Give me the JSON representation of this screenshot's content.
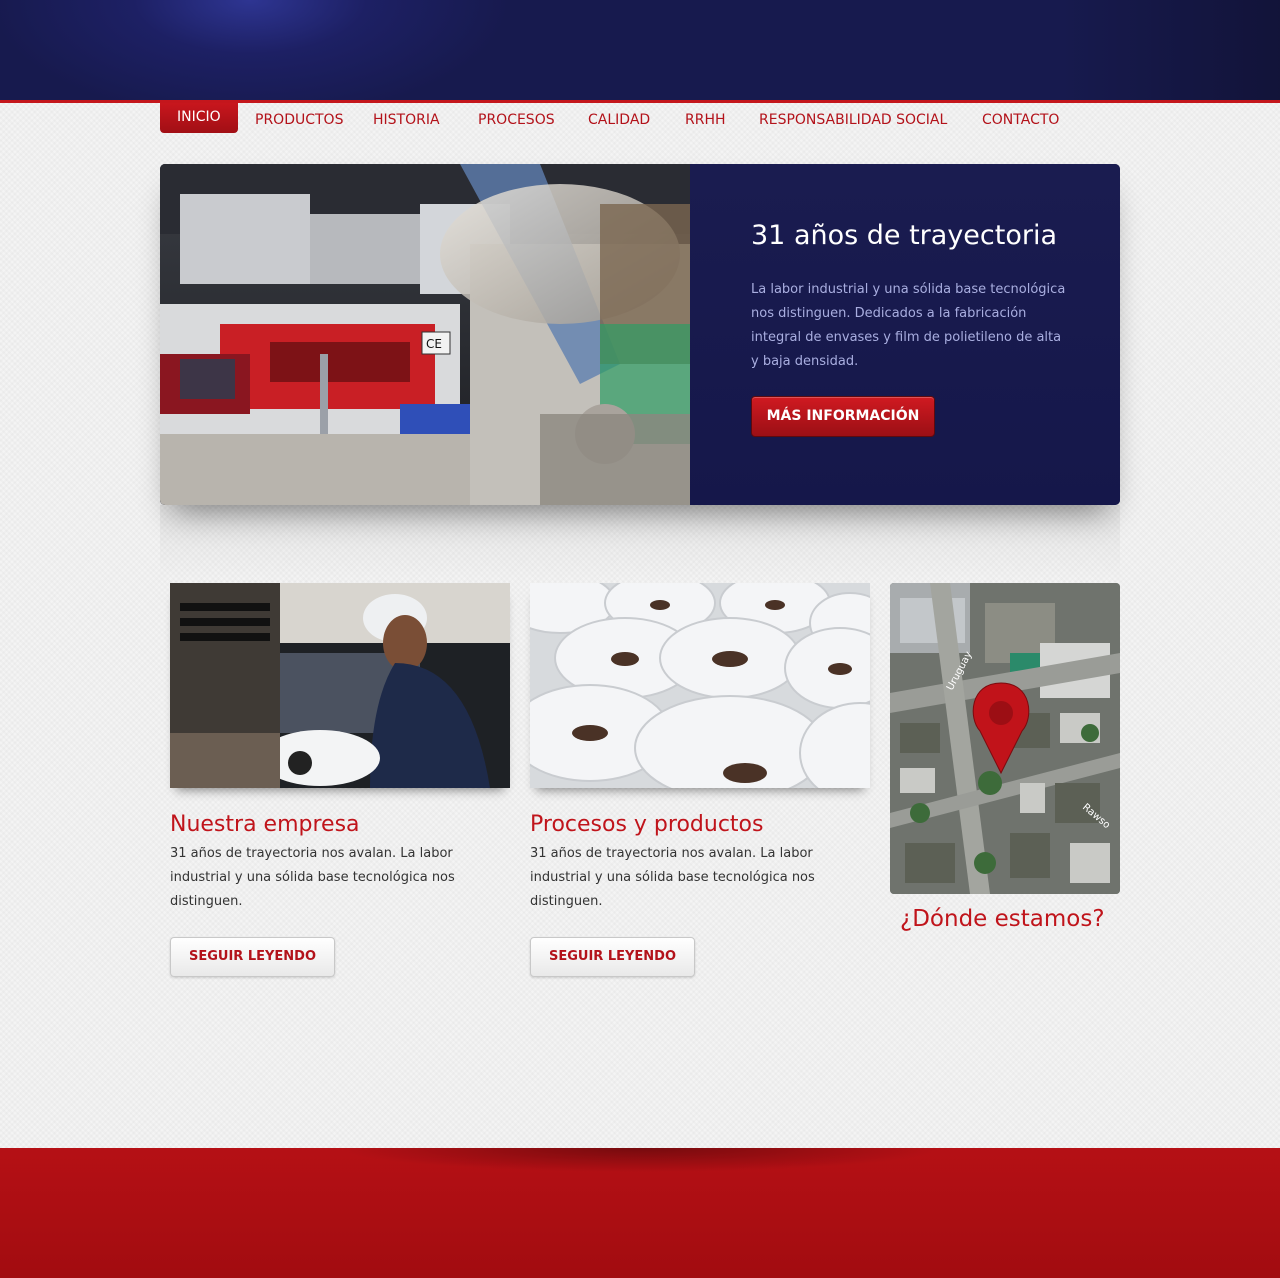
{
  "nav": {
    "items": [
      {
        "label": "INICIO"
      },
      {
        "label": "PRODUCTOS"
      },
      {
        "label": "HISTORIA"
      },
      {
        "label": "PROCESOS"
      },
      {
        "label": "CALIDAD"
      },
      {
        "label": "RRHH"
      },
      {
        "label": "RESPONSABILIDAD SOCIAL"
      },
      {
        "label": "CONTACTO"
      }
    ],
    "active": "INICIO"
  },
  "hero": {
    "title": "31 años de trayectoria",
    "text": "La labor industrial y una sólida base tecnológica nos distinguen. Dedicados a la fabricación integral de envases y film de polietileno de alta y baja densidad.",
    "button_label": "MÁS INFORMACIÓN",
    "image_label": "CE"
  },
  "cards": [
    {
      "title": "Nuestra empresa",
      "text": "31 años de trayectoria nos avalan. La labor industrial y una sólida base tecnológica nos distinguen.",
      "button_label": "SEGUIR LEYENDO"
    },
    {
      "title": "Procesos y productos",
      "text": "31 años de trayectoria nos avalan. La labor industrial y una sólida base tecnológica nos distinguen.",
      "button_label": "SEGUIR LEYENDO"
    }
  ],
  "map": {
    "title": "¿Dónde estamos?",
    "street_1": "Uruguay",
    "street_2": "Rawso",
    "marker_icon": "map-pin-icon"
  },
  "colors": {
    "brand_red": "#c0141b",
    "header_blue": "#1a1c4e",
    "footer_red": "#a80d11"
  }
}
